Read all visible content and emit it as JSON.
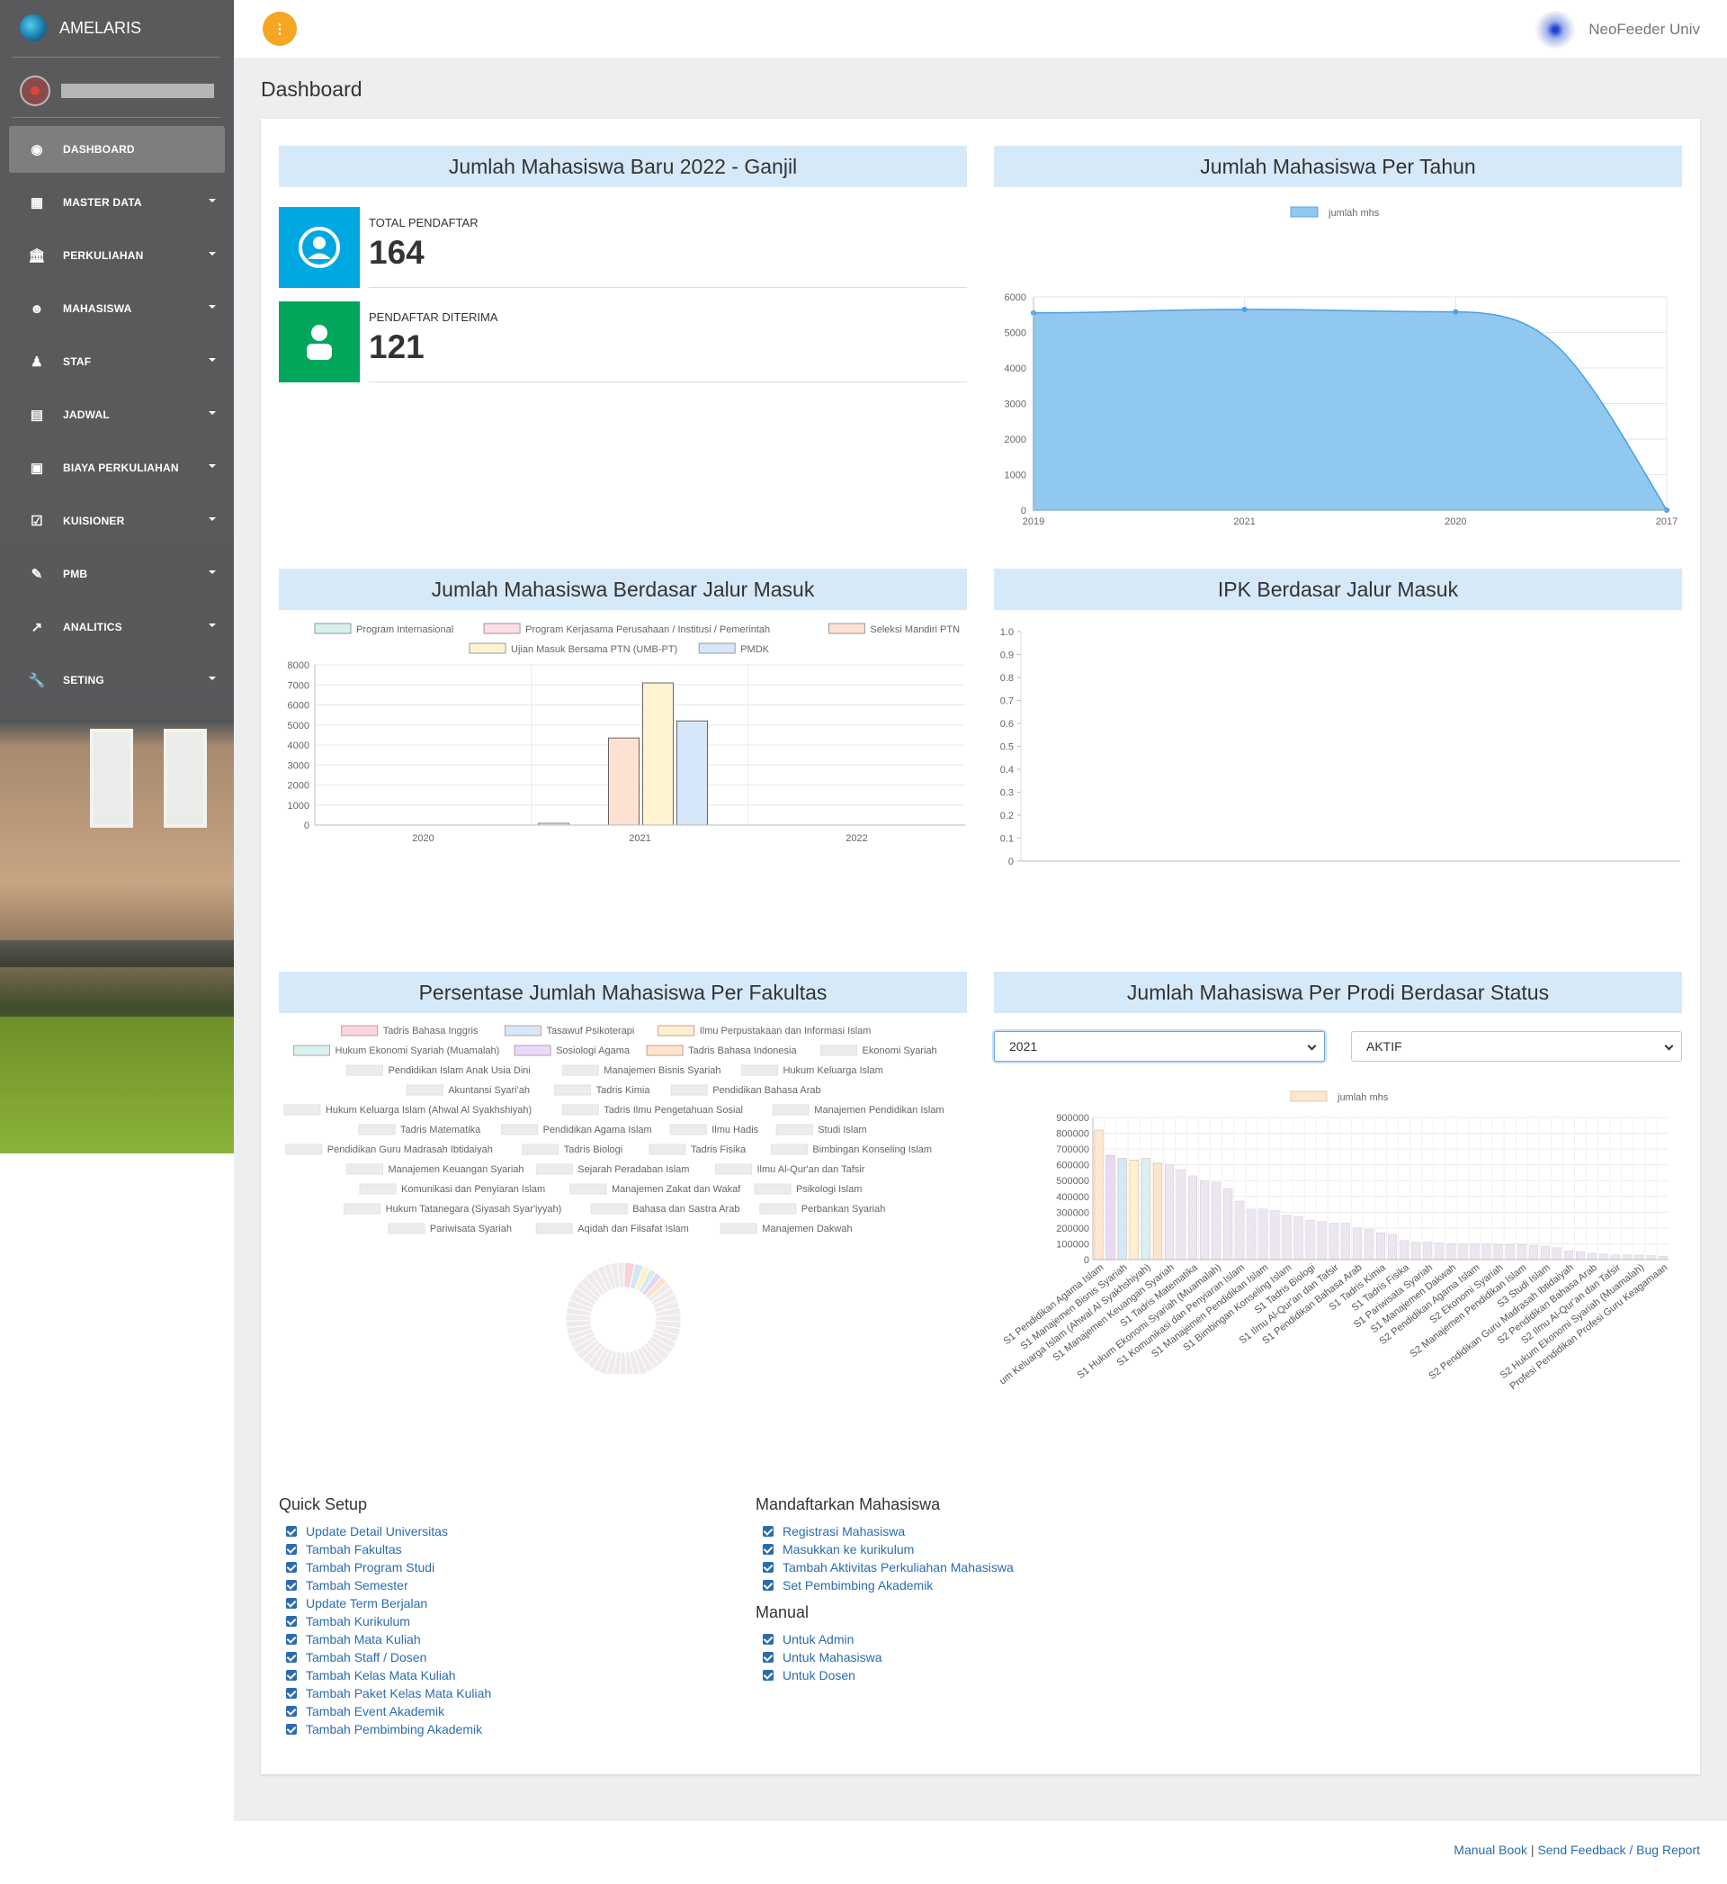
{
  "app": {
    "name": "AMELARIS",
    "partner": "NeoFeeder Univ"
  },
  "sidebar": {
    "menu": [
      {
        "label": "DASHBOARD",
        "icon": "dashboard-icon",
        "glyph": "◉",
        "active": true,
        "caret": false
      },
      {
        "label": "MASTER DATA",
        "icon": "table-icon",
        "glyph": "▦",
        "active": false,
        "caret": true
      },
      {
        "label": "PERKULIAHAN",
        "icon": "institution-icon",
        "glyph": "🏛",
        "active": false,
        "caret": true
      },
      {
        "label": "MAHASISWA",
        "icon": "user-circle-icon",
        "glyph": "☻",
        "active": false,
        "caret": true
      },
      {
        "label": "STAF",
        "icon": "user-icon",
        "glyph": "♟",
        "active": false,
        "caret": true
      },
      {
        "label": "JADWAL",
        "icon": "calendar-icon",
        "glyph": "▤",
        "active": false,
        "caret": true
      },
      {
        "label": "BIAYA PERKULIAHAN",
        "icon": "money-icon",
        "glyph": "▣",
        "active": false,
        "caret": true
      },
      {
        "label": "KUISIONER",
        "icon": "check-square-icon",
        "glyph": "☑",
        "active": false,
        "caret": true
      },
      {
        "label": "PMB",
        "icon": "edit-icon",
        "glyph": "✎",
        "active": false,
        "caret": true
      },
      {
        "label": "ANALITICS",
        "icon": "line-chart-icon",
        "glyph": "↗",
        "active": false,
        "caret": true
      },
      {
        "label": "SETING",
        "icon": "wrench-icon",
        "glyph": "🔧",
        "active": false,
        "caret": true
      }
    ]
  },
  "topbar": {
    "menu_glyph": "⋮"
  },
  "page": {
    "title": "Dashboard"
  },
  "panels": {
    "new_students": {
      "title": "Jumlah Mahasiswa Baru 2022 - Ganjil",
      "stats": [
        {
          "label": "TOTAL PENDAFTAR",
          "value": "164",
          "color": "#00a8e1"
        },
        {
          "label": "PENDAFTAR DITERIMA",
          "value": "121",
          "color": "#00a65a"
        }
      ]
    },
    "per_year": {
      "title": "Jumlah Mahasiswa Per Tahun"
    },
    "jalur": {
      "title": "Jumlah Mahasiswa Berdasar Jalur Masuk"
    },
    "ipk": {
      "title": "IPK Berdasar Jalur Masuk"
    },
    "fakultas": {
      "title": "Persentase Jumlah Mahasiswa Per Fakultas"
    },
    "prodi_status": {
      "title": "Jumlah Mahasiswa Per Prodi Berdasar Status",
      "year_select": "2021",
      "status_select": "AKTIF"
    }
  },
  "chart_data": [
    {
      "type": "area",
      "x": [
        "2019",
        "2021",
        "2020",
        "2017"
      ],
      "series": [
        {
          "name": "jumlah mhs",
          "values": [
            5550,
            5650,
            5580,
            0
          ]
        }
      ],
      "ylim": [
        0,
        6000
      ],
      "yticks": [
        "0",
        "1000",
        "2000",
        "3000",
        "4000",
        "5000",
        "6000"
      ],
      "color": "#90c8f0",
      "legend": "top"
    },
    {
      "type": "bar",
      "categories": [
        "2020",
        "2021",
        "2022"
      ],
      "series": [
        {
          "name": "Program Internasional",
          "values": [
            0,
            0,
            0
          ],
          "color": "#d8f0ec"
        },
        {
          "name": "Program Kerjasama Perusahaan / Institusi / Pemerintah",
          "values": [
            0,
            0,
            0
          ],
          "color": "#fcdde4"
        },
        {
          "name": "Seleksi Mandiri PTN",
          "values": [
            0,
            4350,
            0
          ],
          "color": "#fde2d2"
        },
        {
          "name": "Ujian Masuk Bersama PTN (UMB-PT)",
          "values": [
            0,
            7100,
            0
          ],
          "color": "#fff3d2"
        },
        {
          "name": "PMDK",
          "values": [
            0,
            5200,
            0
          ],
          "color": "#d6e7f9"
        },
        {
          "name": "",
          "values": [
            0,
            90,
            0
          ],
          "color": "#e6e6e6"
        }
      ],
      "ylim": [
        0,
        8000
      ],
      "yticks": [
        "0",
        "1000",
        "2000",
        "3000",
        "4000",
        "5000",
        "6000",
        "7000",
        "8000"
      ],
      "legend": "top"
    },
    {
      "type": "bar",
      "categories": [],
      "series": [],
      "ylim": [
        0,
        1.0
      ],
      "yticks": [
        "0",
        "0.1",
        "0.2",
        "0.3",
        "0.4",
        "0.5",
        "0.6",
        "0.7",
        "0.8",
        "0.9",
        "1.0"
      ]
    },
    {
      "type": "pie",
      "legend": [
        [
          "Tadris Bahasa Inggris",
          "Tasawuf Psikoterapi",
          "Ilmu Perpustakaan dan Informasi Islam"
        ],
        [
          "Hukum Ekonomi Syariah (Muamalah)",
          "Sosiologi Agama",
          "Tadris Bahasa Indonesia",
          "Ekonomi Syariah"
        ],
        [
          "Pendidikan Islam Anak Usia Dini",
          "Manajemen Bisnis Syariah",
          "Hukum Keluarga Islam"
        ],
        [
          "Akuntansi Syari'ah",
          "Tadris Kimia",
          "Pendidikan Bahasa Arab"
        ],
        [
          "Hukum Keluarga Islam (Ahwal Al Syakhshiyah)",
          "Tadris Ilmu Pengetahuan Sosial",
          "Manajemen Pendidikan Islam"
        ],
        [
          "Tadris Matematika",
          "Pendidikan Agama Islam",
          "Ilmu Hadis",
          "Studi Islam"
        ],
        [
          "Pendidikan Guru Madrasah Ibtidaiyah",
          "Tadris Biologi",
          "Tadris Fisika",
          "Bimbingan Konseling  Islam"
        ],
        [
          "Manajemen Keuangan Syariah",
          "Sejarah Peradaban  Islam",
          "Ilmu Al-Qur'an dan Tafsir"
        ],
        [
          "Komunikasi dan Penyiaran Islam",
          "Manajemen Zakat dan Wakaf",
          "Psikologi Islam"
        ],
        [
          "Hukum Tatanegara (Siyasah Syar'iyyah)",
          "Bahasa dan Sastra Arab",
          "Perbankan Syariah"
        ],
        [
          "Pariwisata Syariah",
          "Aqidah dan Filsafat Islam",
          "Manajemen Dakwah"
        ]
      ],
      "legend_colors": [
        "#fcd5dc",
        "#d4e8fb",
        "#fff1cf",
        "#d6f1f0",
        "#e6dafb",
        "#fde4cc"
      ],
      "slices": [
        3,
        2.5,
        2,
        2,
        2,
        2,
        2,
        2,
        2,
        2,
        2,
        2,
        2,
        2,
        2,
        2,
        2,
        2,
        2,
        2,
        2,
        2,
        2,
        2,
        2,
        2,
        2,
        2,
        2,
        2,
        2,
        2,
        2,
        2,
        2,
        2,
        2,
        2,
        2,
        2,
        2,
        2,
        2,
        2,
        2,
        2,
        2,
        2,
        2,
        2
      ]
    },
    {
      "type": "bar",
      "series": [
        {
          "name": "jumlah mhs",
          "color": "#fde7d2"
        }
      ],
      "ylim": [
        0,
        900000
      ],
      "yticks": [
        "0",
        "100000",
        "200000",
        "300000",
        "400000",
        "500000",
        "600000",
        "700000",
        "800000",
        "900000"
      ],
      "values": [
        820000,
        660000,
        640000,
        630000,
        640000,
        610000,
        600000,
        570000,
        530000,
        500000,
        490000,
        450000,
        370000,
        320000,
        320000,
        310000,
        280000,
        270000,
        250000,
        240000,
        230000,
        230000,
        200000,
        190000,
        170000,
        160000,
        120000,
        110000,
        110000,
        105000,
        100000,
        100000,
        100000,
        100000,
        95000,
        95000,
        95000,
        90000,
        85000,
        75000,
        55000,
        50000,
        40000,
        35000,
        30000,
        30000,
        28000,
        25000,
        22000
      ],
      "bar_colors": [
        "#fde7d2",
        "#e6dafb",
        "#d4e8fb",
        "#fff1cf",
        "#d6f1f0",
        "#fde4cc",
        "#ede6f0"
      ],
      "labels": [
        "S1 Pendidikan Agama Islam",
        "S1 Manajemen Bisnis Syariah",
        "um Keluarga Islam (Ahwal Al Syakhshiyah)",
        "S1 Manajemen Keuangan Syariah",
        "S1 Tadris Matematika",
        "S1 Hukum Ekonomi Syariah (Muamalah)",
        "S1 Komunikasi dan Penyiaran Islam",
        "S1 Manajemen Pendidikan Islam",
        "S1 Bimbingan Konseling  Islam",
        "S1 Tadris Biologi",
        "S1 Ilmu Al-Qur'an dan Tafsir",
        "S1 Pendidikan Bahasa Arab",
        "S1 Tadris Kimia",
        "S1 Tadris Fisika",
        "S1 Pariwisata Syariah",
        "S1 Manajemen Dakwah",
        "S2 Pendidikan Agama Islam",
        "S2 Ekonomi Syariah",
        "S2 Manajemen Pendidikan Islam",
        "S3 Studi Islam",
        "S2 Pendidikan Guru Madrasah Ibtidaiyah",
        "S2 Pendidikan Bahasa Arab",
        "S2 Ilmu Al-Qur'an dan Tafsir",
        "S2 Hukum Ekonomi Syariah (Muamalah)",
        "Profesi Pendidikan Profesi Guru Keagamaan"
      ],
      "legend": "top"
    }
  ],
  "quick_setup": {
    "title": "Quick Setup",
    "items": [
      "Update Detail Universitas",
      "Tambah Fakultas",
      "Tambah Program Studi",
      "Tambah Semester",
      "Update Term Berjalan",
      "Tambah Kurikulum",
      "Tambah Mata Kuliah",
      "Tambah Staff / Dosen",
      "Tambah Kelas Mata Kuliah",
      "Tambah Paket Kelas Mata Kuliah",
      "Tambah Event Akademik",
      "Tambah Pembimbing Akademik"
    ]
  },
  "register": {
    "title": "Mandaftarkan Mahasiswa",
    "items": [
      "Registrasi Mahasiswa",
      "Masukkan ke kurikulum",
      "Tambah Aktivitas Perkuliahan Mahasiswa",
      "Set Pembimbing Akademik"
    ]
  },
  "manual": {
    "title": "Manual",
    "items": [
      "Untuk Admin",
      "Untuk Mahasiswa",
      "Untuk Dosen"
    ]
  },
  "footer": {
    "manual_book": "Manual Book",
    "sep": "|",
    "feedback": "Send Feedback / Bug Report"
  }
}
